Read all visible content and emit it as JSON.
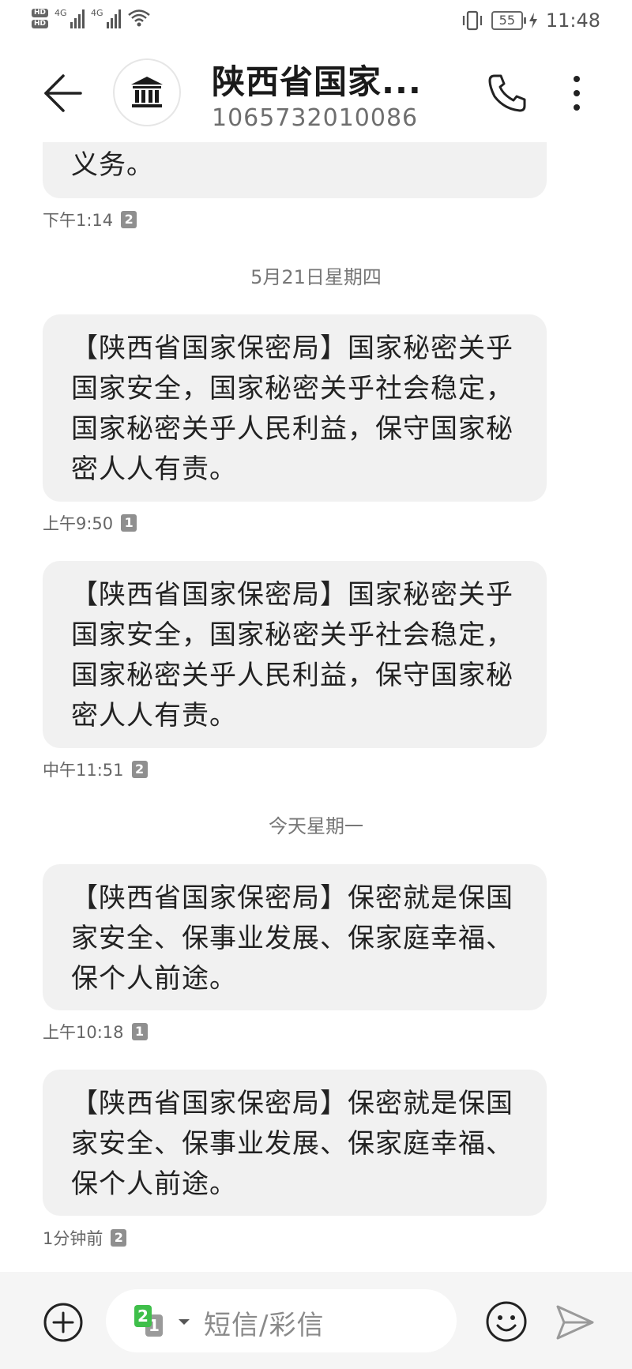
{
  "status_bar": {
    "hd1": "HD",
    "hd2": "HD",
    "net1": "4G",
    "net2": "4G",
    "battery": "55",
    "time": "11:48"
  },
  "header": {
    "title": "陕西省国家...",
    "number": "1065732010086"
  },
  "messages": [
    {
      "text": "义务。",
      "time": "下午1:14",
      "sim": "2",
      "partial": true
    },
    {
      "date": "5月21日星期四"
    },
    {
      "text": "【陕西省国家保密局】国家秘密关乎国家安全，国家秘密关乎社会稳定，国家秘密关乎人民利益，保守国家秘密人人有责。",
      "time": "上午9:50",
      "sim": "1"
    },
    {
      "text": "【陕西省国家保密局】国家秘密关乎国家安全，国家秘密关乎社会稳定，国家秘密关乎人民利益，保守国家秘密人人有责。",
      "time": "中午11:51",
      "sim": "2"
    },
    {
      "date": "今天星期一"
    },
    {
      "text": "【陕西省国家保密局】保密就是保国家安全、保事业发展、保家庭幸福、保个人前途。",
      "time": "上午10:18",
      "sim": "1"
    },
    {
      "text": "【陕西省国家保密局】保密就是保国家安全、保事业发展、保家庭幸福、保个人前途。",
      "time": "1分钟前",
      "sim": "2"
    }
  ],
  "input": {
    "sim_primary": "2",
    "sim_secondary": "1",
    "placeholder": "短信/彩信"
  },
  "colors": {
    "bubble": "#f1f1f1",
    "sim_active": "#3fbf4a",
    "input_bar": "#f5f5f5"
  },
  "icons": [
    "back-arrow-icon",
    "bank-icon",
    "phone-icon",
    "more-vertical-icon",
    "plus-circle-icon",
    "emoji-icon",
    "send-icon"
  ]
}
